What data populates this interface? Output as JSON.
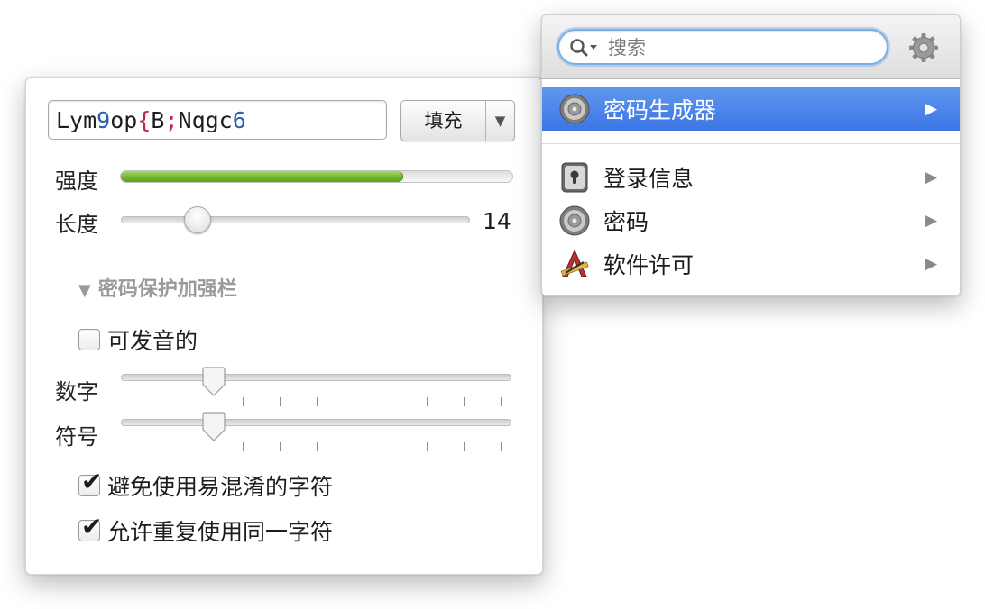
{
  "generator": {
    "password_segments": [
      {
        "text": "Lym",
        "kind": "alpha"
      },
      {
        "text": "9",
        "kind": "num"
      },
      {
        "text": "op",
        "kind": "alpha"
      },
      {
        "text": "{",
        "kind": "sym"
      },
      {
        "text": "B",
        "kind": "alpha"
      },
      {
        "text": ";",
        "kind": "sym"
      },
      {
        "text": "Nqgc",
        "kind": "alpha"
      },
      {
        "text": "6",
        "kind": "num"
      }
    ],
    "fill_button_label": "填充",
    "strength_label": "强度",
    "strength_fraction": 0.72,
    "length_label": "长度",
    "length_value": "14",
    "length_fraction": 0.22,
    "disclosure_label": "密码保护加强栏",
    "pronounceable": {
      "label": "可发音的",
      "checked": false
    },
    "digits_label": "数字",
    "digits_fraction": 0.22,
    "symbols_label": "符号",
    "symbols_fraction": 0.22,
    "tick_count": 11,
    "avoid_ambiguous": {
      "label": "避免使用易混淆的字符",
      "checked": true
    },
    "allow_repeat": {
      "label": "允许重复使用同一字符",
      "checked": true
    }
  },
  "menu": {
    "search_placeholder": "搜索",
    "items": [
      {
        "label": "密码生成器",
        "icon": "vault-dial-icon",
        "selected": true
      },
      {
        "label": "登录信息",
        "icon": "keyhole-icon",
        "selected": false
      },
      {
        "label": "密码",
        "icon": "vault-dial-icon",
        "selected": false
      },
      {
        "label": "软件许可",
        "icon": "app-store-icon",
        "selected": false
      }
    ],
    "colors": {
      "selection": "#3b76e4",
      "focus_ring": "#7eaee6",
      "strength": "#6db22a"
    }
  }
}
